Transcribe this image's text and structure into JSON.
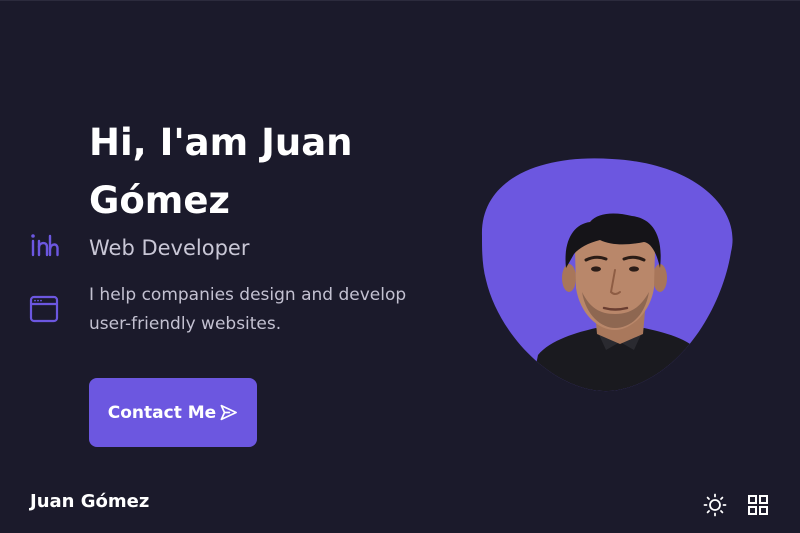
{
  "hero": {
    "title_line1": "Hi, I'am Juan",
    "title_line2": "Gómez",
    "subtitle": "Web Developer",
    "description": "I help companies design and develop user-friendly websites.",
    "contact_label": "Contact Me"
  },
  "social": {
    "icons": [
      "linkedin-icon",
      "browser-window-icon"
    ]
  },
  "footer": {
    "logo": "Juan Gómez"
  },
  "icons": {
    "contact": "send-icon",
    "theme": "sun-icon",
    "menu": "grid-menu-icon"
  },
  "colors": {
    "background": "#1b1a2b",
    "accent": "#6c57e0",
    "title": "#ffffff",
    "subtitle": "#c9c7d6"
  }
}
